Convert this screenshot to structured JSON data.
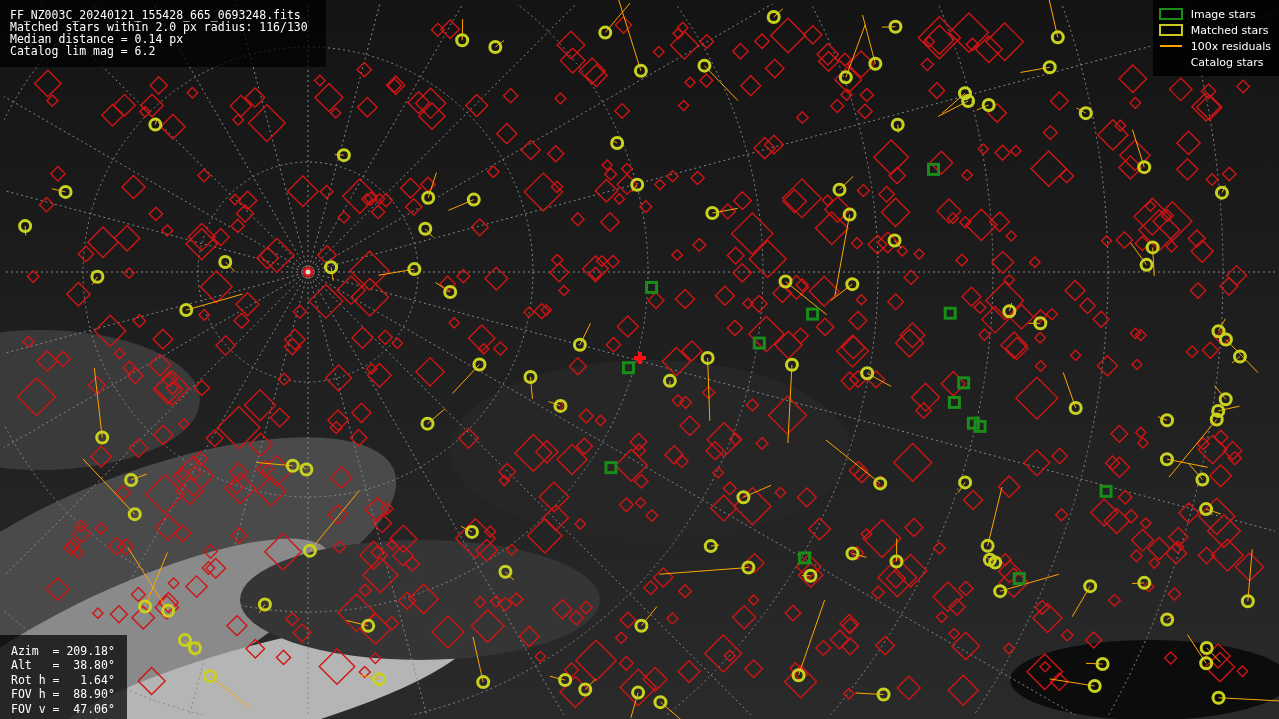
{
  "fit_info": {
    "lines": [
      "FF_NZ003C_20240121_155428_665_0693248.fits",
      "Matched stars within 2.0 px radius: 116/130",
      "Median distance = 0.14 px",
      "Catalog lim mag = 6.2"
    ]
  },
  "legend": [
    {
      "kind": "box",
      "color": "#1a8c1a",
      "label": "Image stars"
    },
    {
      "kind": "box",
      "color": "#c8c81e",
      "label": "Matched stars"
    },
    {
      "kind": "line",
      "color": "#ffa500",
      "label": "100x residuals"
    },
    {
      "kind": "blank",
      "label": "Catalog stars"
    }
  ],
  "pointing": {
    "lines": [
      "Azim  = 209.18°",
      "Alt   =  38.80°",
      "Rot h =   1.64°",
      "FOV h =  88.90°",
      "FOV v =  47.06°"
    ]
  }
}
